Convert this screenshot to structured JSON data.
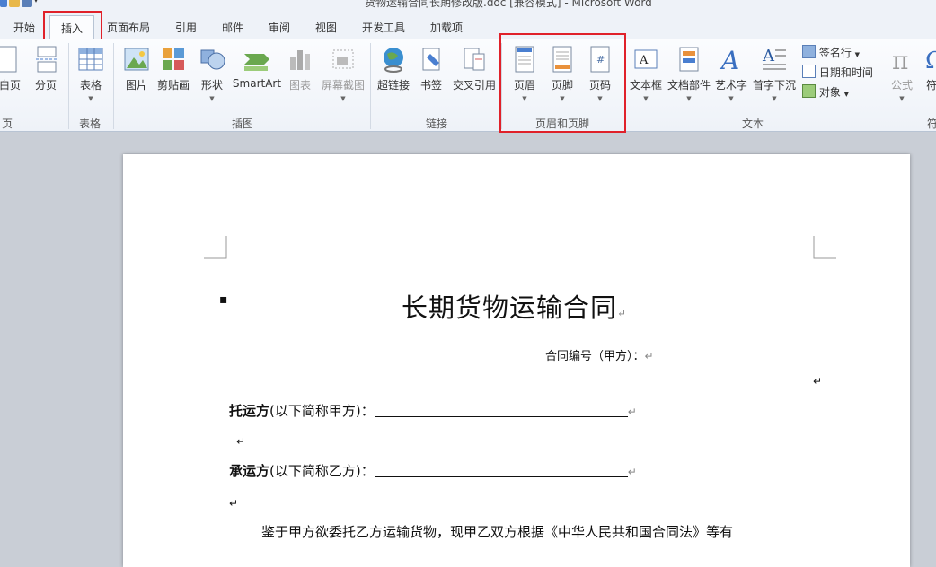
{
  "window": {
    "title": "货物运输合同长期修改版.doc [兼容模式] - Microsoft Word"
  },
  "tabs": [
    "开始",
    "插入",
    "页面布局",
    "引用",
    "邮件",
    "审阅",
    "视图",
    "开发工具",
    "加载项"
  ],
  "ribbon": {
    "pages": {
      "blank_page": "白页",
      "page_break": "分页",
      "group": "页"
    },
    "tables": {
      "table": "表格",
      "group": "表格"
    },
    "illustrations": {
      "picture": "图片",
      "clipart": "剪贴画",
      "shapes": "形状",
      "smartart": "SmartArt",
      "chart": "图表",
      "screenshot": "屏幕截图",
      "group": "插图"
    },
    "links": {
      "hyperlink": "超链接",
      "bookmark": "书签",
      "crossref": "交叉引用",
      "group": "链接"
    },
    "header_footer": {
      "header": "页眉",
      "footer": "页脚",
      "page_number": "页码",
      "group": "页眉和页脚"
    },
    "text": {
      "textbox": "文本框",
      "quickparts": "文档部件",
      "wordart": "艺术字",
      "dropcap": "首字下沉",
      "signature": "签名行",
      "datetime": "日期和时间",
      "object": "对象",
      "group": "文本"
    },
    "symbols": {
      "equation": "公式",
      "symbol": "符",
      "group": "符"
    }
  },
  "document": {
    "title": "长期货物运输合同",
    "contract_no": "合同编号（甲方）：",
    "shipper_bold": "托运方",
    "shipper_rest": "(以下简称甲方)：",
    "carrier_bold": "承运方",
    "carrier_rest": "(以下简称乙方)：",
    "body": "鉴于甲方欲委托乙方运输货物，现甲乙双方根据《中华人民共和国合同法》等有",
    "para_mark": "↵",
    "bullet": "▪"
  }
}
